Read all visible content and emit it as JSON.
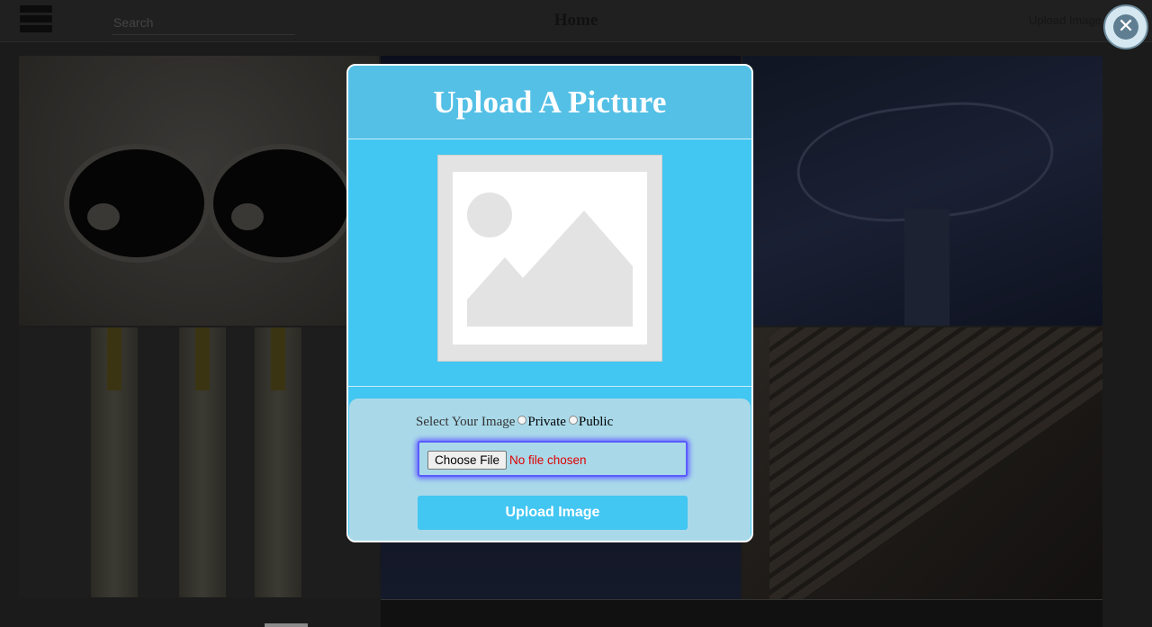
{
  "header": {
    "search_placeholder": "Search",
    "title": "Home",
    "upload_link": "Upload Image"
  },
  "modal": {
    "title": "Upload A Picture",
    "select_label": "Select Your Image",
    "privacy_options": [
      "Private",
      "Public"
    ],
    "choose_file_label": "Choose File",
    "file_status": "No file chosen",
    "submit_label": "Upload Image",
    "close_symbol": "✕"
  },
  "icons": {
    "menu": "hamburger-icon",
    "close": "close-icon",
    "image_placeholder": "image-placeholder-icon"
  },
  "colors": {
    "modal_bg": "#42c6f2",
    "modal_header": "#55c0e6",
    "form_bg": "#a9d9e9",
    "file_status": "#e00000",
    "focus_ring": "#5b5bff"
  }
}
